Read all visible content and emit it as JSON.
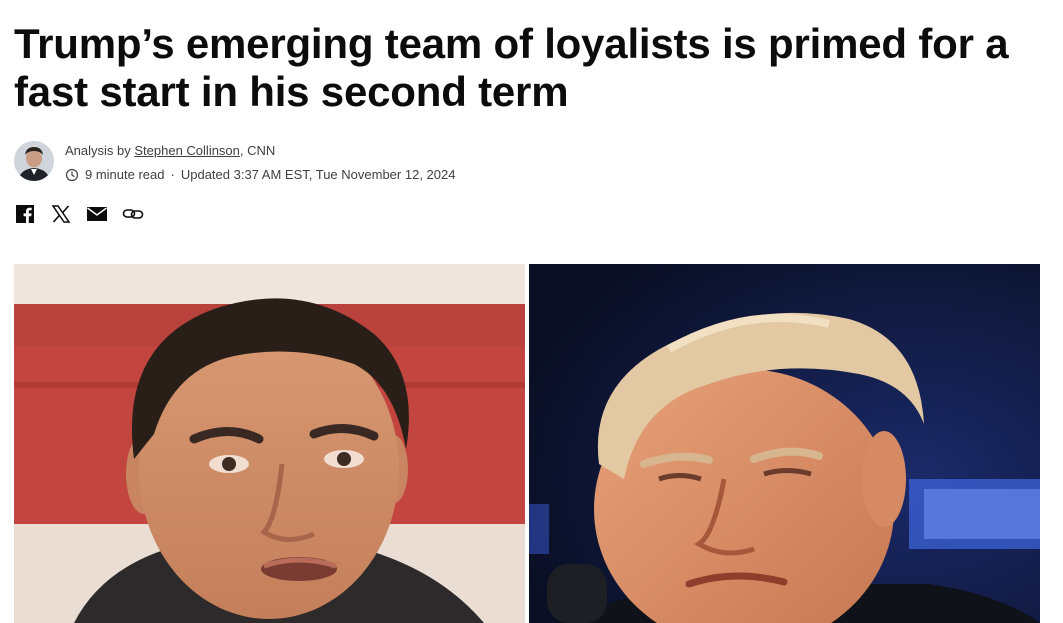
{
  "article": {
    "headline": "Trump’s emerging team of loyalists is primed for a fast start in his second term",
    "byline": {
      "prefix": "Analysis by ",
      "author": "Stephen Collinson",
      "outlet": ", CNN",
      "read_time": "9 minute read",
      "separator": "·",
      "updated": "Updated 3:37 AM EST, Tue November 12, 2024"
    },
    "share": {
      "icons": [
        "facebook-icon",
        "x-icon",
        "email-icon",
        "link-icon"
      ]
    },
    "photos": [
      {
        "subject": "left-portrait",
        "backdrop": "red-white-stripes"
      },
      {
        "subject": "right-portrait",
        "backdrop": "dark-blue"
      }
    ]
  },
  "colors": {
    "text": "#0c0c0c",
    "meta_text": "#404040",
    "background": "#ffffff"
  }
}
